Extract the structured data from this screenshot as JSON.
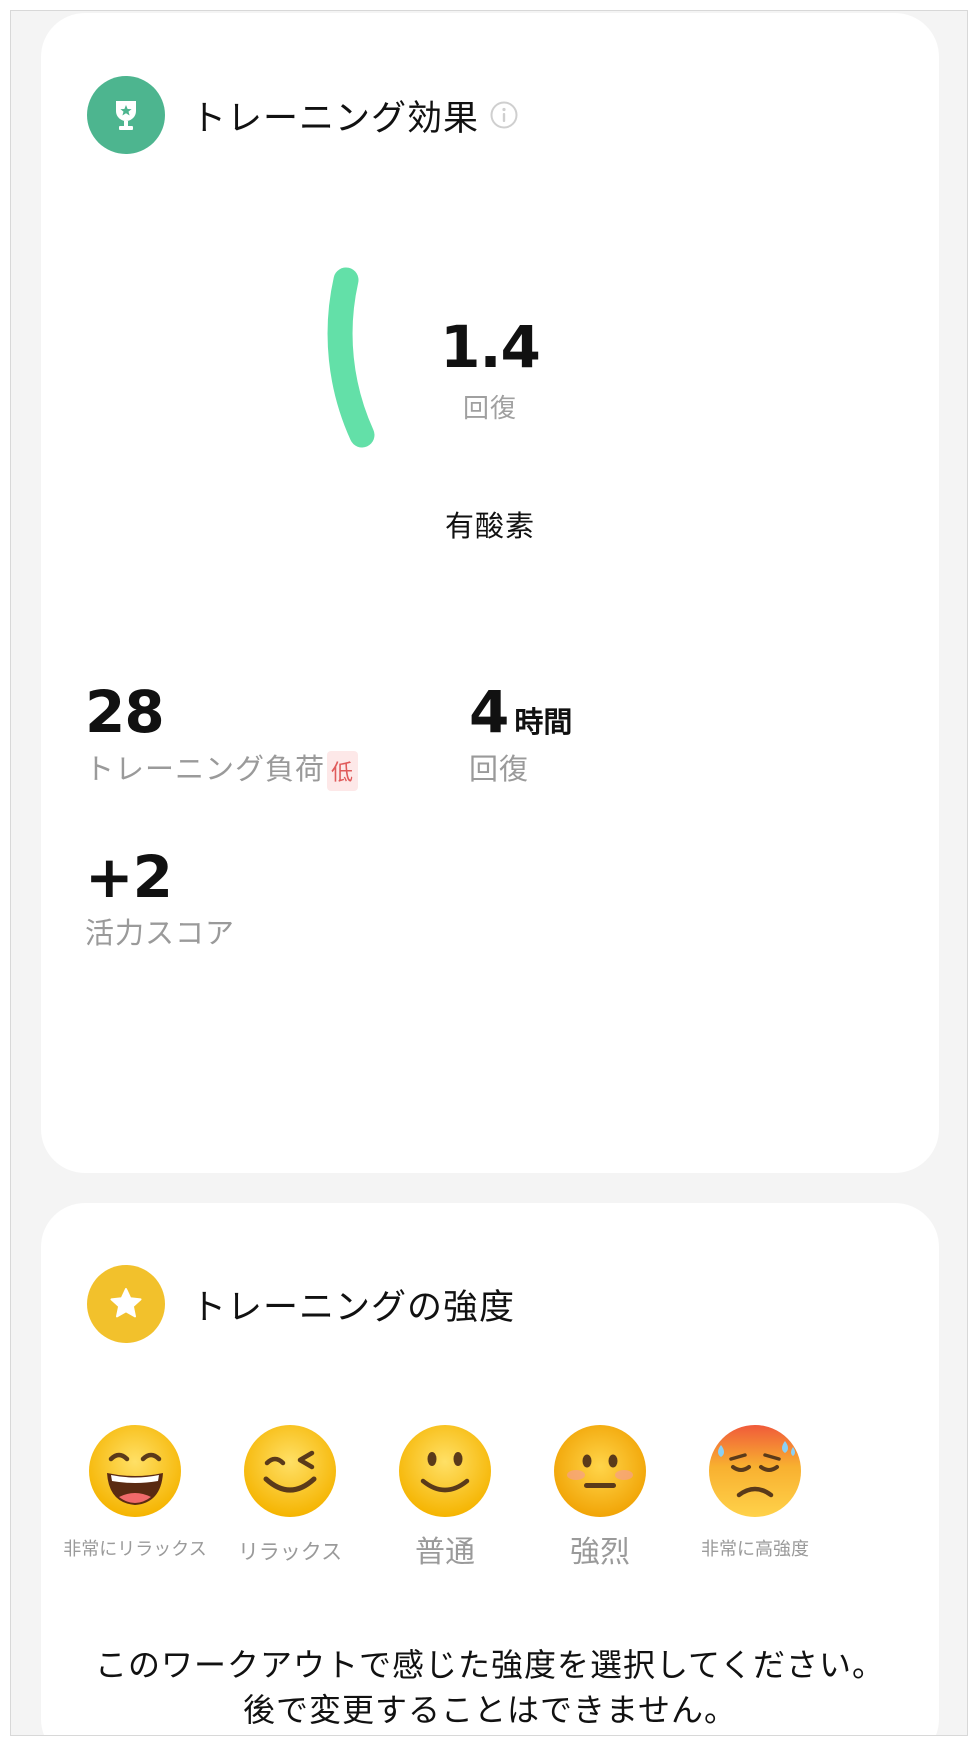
{
  "effect_card": {
    "title": "トレーニング効果",
    "gauge_value": "1.4",
    "gauge_sub": "回復",
    "gauge_category": "有酸素",
    "training_load_value": "28",
    "training_load_label": "トレーニング負荷",
    "training_load_tag": "低",
    "recovery_value": "4",
    "recovery_unit": "時間",
    "recovery_label": "回復",
    "vitality_value": "+2",
    "vitality_label": "活力スコア",
    "accent_color": "#4db58f",
    "gauge_color": "#63e0a8"
  },
  "intensity_card": {
    "title": "トレーニングの強度",
    "accent_color": "#f2c12c",
    "options": [
      {
        "label": "非常にリラックス",
        "icon": "grinning-face-icon"
      },
      {
        "label": "リラックス",
        "icon": "winking-face-icon"
      },
      {
        "label": "普通",
        "icon": "smiling-face-icon"
      },
      {
        "label": "強烈",
        "icon": "neutral-face-icon"
      },
      {
        "label": "非常に高強度",
        "icon": "exhausted-sweating-face-icon"
      }
    ],
    "prompt_line1": "このワークアウトで感じた強度を選択してください。",
    "prompt_line2": "後で変更することはできません。"
  }
}
